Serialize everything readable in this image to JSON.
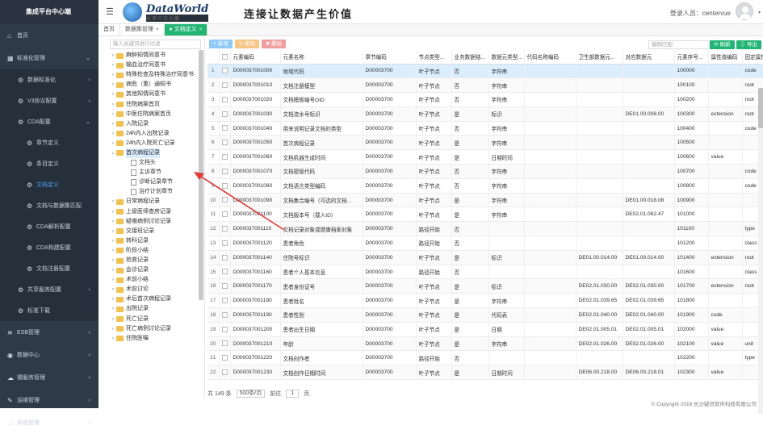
{
  "brand": "集成平台中心端",
  "sidebar": [
    {
      "label": "首页",
      "icon": "home-icon",
      "glyph": "⌂"
    },
    {
      "label": "标准化管理",
      "icon": "grid-icon",
      "glyph": "▦",
      "arrow": "⌄"
    },
    {
      "label": "数据标准化",
      "icon": "gear-icon",
      "glyph": "⚙",
      "arrow": "‹",
      "level": 1
    },
    {
      "label": "V3协议配置",
      "icon": "gear-icon",
      "glyph": "⚙",
      "arrow": "‹",
      "level": 1
    },
    {
      "label": "CDA配置",
      "icon": "gear-icon",
      "glyph": "⚙",
      "arrow": "⌄",
      "level": 1
    },
    {
      "label": "章节定义",
      "icon": "gear-icon",
      "glyph": "⚙",
      "level": 2
    },
    {
      "label": "条目定义",
      "icon": "gear-icon",
      "glyph": "⚙",
      "level": 2
    },
    {
      "label": "文档定义",
      "icon": "gear-icon",
      "glyph": "⚙",
      "level": 2,
      "active": true
    },
    {
      "label": "文档与数据集匹配",
      "icon": "gear-icon",
      "glyph": "⚙",
      "level": 2
    },
    {
      "label": "CDA解析配置",
      "icon": "gear-icon",
      "glyph": "⚙",
      "level": 2
    },
    {
      "label": "CDA构建配置",
      "icon": "gear-icon",
      "glyph": "⚙",
      "level": 2
    },
    {
      "label": "文档注册配置",
      "icon": "gear-icon",
      "glyph": "⚙",
      "level": 2
    },
    {
      "label": "共享服务配置",
      "icon": "gear-icon",
      "glyph": "⚙",
      "arrow": "‹",
      "level": 1
    },
    {
      "label": "标准下载",
      "icon": "gear-icon",
      "glyph": "⚙",
      "level": 1
    },
    {
      "label": "ESB管理",
      "icon": "layers-icon",
      "glyph": "≋",
      "arrow": "‹"
    },
    {
      "label": "数据中心",
      "icon": "database-icon",
      "glyph": "◉",
      "arrow": "‹"
    },
    {
      "label": "微服务管理",
      "icon": "cloud-icon",
      "glyph": "☁",
      "arrow": "‹"
    },
    {
      "label": "运维管理",
      "icon": "wrench-icon",
      "glyph": "✎",
      "arrow": "‹"
    },
    {
      "label": "系统管理",
      "icon": "monitor-icon",
      "glyph": "▭",
      "arrow": "‹"
    }
  ],
  "header": {
    "logo_name": "DataWorld",
    "logo_sub": "共享开放共赢",
    "slogan": "连接让数据产生价值",
    "user_label": "登录人员：centervue",
    "menu_icon": "☰",
    "avatar_arrow": "▾"
  },
  "tabs": [
    {
      "label": "首页"
    },
    {
      "label": "数据集管理",
      "close": "×"
    },
    {
      "label": "● 文档定义",
      "close": "×",
      "active": true
    }
  ],
  "tree": {
    "search_placeholder": "输入关键词进行过滤",
    "items": [
      {
        "label": "麻醉知情同意书",
        "t": "f"
      },
      {
        "label": "输血治疗同意书",
        "t": "f"
      },
      {
        "label": "特殊检查及特殊治疗同意书",
        "t": "f"
      },
      {
        "label": "病危（重）通知书",
        "t": "f"
      },
      {
        "label": "其他知情同意书",
        "t": "f"
      },
      {
        "label": "住院病案首页",
        "t": "f"
      },
      {
        "label": "中医住院病案首页",
        "t": "f"
      },
      {
        "label": "入院记录",
        "t": "f"
      },
      {
        "label": "24h内入出院记录",
        "t": "f"
      },
      {
        "label": "24h内入院死亡记录",
        "t": "f"
      },
      {
        "label": "首次病程记录",
        "t": "o",
        "sel": true
      },
      {
        "label": "文档头",
        "t": "l"
      },
      {
        "label": "主诉章节",
        "t": "l"
      },
      {
        "label": "诊断记录章节",
        "t": "l"
      },
      {
        "label": "治疗计划章节",
        "t": "l"
      },
      {
        "label": "日常病程记录",
        "t": "f"
      },
      {
        "label": "上级医师查房记录",
        "t": "f"
      },
      {
        "label": "疑难病例讨论记录",
        "t": "f"
      },
      {
        "label": "交接班记录",
        "t": "f"
      },
      {
        "label": "转科记录",
        "t": "f"
      },
      {
        "label": "阶段小结",
        "t": "f"
      },
      {
        "label": "抢救记录",
        "t": "f"
      },
      {
        "label": "会诊记录",
        "t": "f"
      },
      {
        "label": "术前小结",
        "t": "f"
      },
      {
        "label": "术前讨论",
        "t": "f"
      },
      {
        "label": "术后首次病程记录",
        "t": "f"
      },
      {
        "label": "出院记录",
        "t": "f"
      },
      {
        "label": "死亡记录",
        "t": "f"
      },
      {
        "label": "死亡病例讨论记录",
        "t": "f"
      },
      {
        "label": "住院医嘱",
        "t": "f"
      }
    ]
  },
  "toolbar": {
    "add": "+ 新增",
    "edit": "✎ 修改",
    "del": "✖ 删除",
    "search_placeholder": "模糊匹配",
    "refresh": "⟳ 刷新",
    "export": "⇩ 导出"
  },
  "columns": [
    "",
    "",
    "元素编码",
    "元素名称",
    "章节编码",
    "节点类型...",
    "业务数据结...",
    "数据元类型...",
    "代码名称编码",
    "卫生部数据元...",
    "对应数据元",
    "元素序号...",
    "属性值编码",
    "固定属性"
  ],
  "rows": [
    [
      "1",
      "D000037001000",
      "地域代码",
      "D00003700",
      "叶子节点",
      "否",
      "字符串",
      "",
      "",
      "",
      "100000",
      "",
      "code"
    ],
    [
      "2",
      "D000037001010",
      "文档注册模型",
      "D00003700",
      "叶子节点",
      "否",
      "字符串",
      "",
      "",
      "",
      "100100",
      "",
      "root"
    ],
    [
      "3",
      "D000037001020",
      "文档模板编号OID",
      "D00003700",
      "叶子节点",
      "否",
      "字符串",
      "",
      "",
      "",
      "100200",
      "",
      "root"
    ],
    [
      "4",
      "D000037001030",
      "文档流水号标识",
      "D00003700",
      "叶子节点",
      "是",
      "标识",
      "",
      "",
      "DE01.00.008.00",
      "100300",
      "extension",
      "root"
    ],
    [
      "5",
      "D000037001040",
      "用来说明记录文档的类型",
      "D00003700",
      "叶子节点",
      "否",
      "字符串",
      "",
      "",
      "",
      "100400",
      "",
      "code"
    ],
    [
      "6",
      "D000037001050",
      "首次病程记录",
      "D00003700",
      "叶子节点",
      "是",
      "字符串",
      "",
      "",
      "",
      "100500",
      "",
      ""
    ],
    [
      "7",
      "D000037001060",
      "文档机器生成时间",
      "D00003700",
      "叶子节点",
      "是",
      "日期时间",
      "",
      "",
      "",
      "100600",
      "value",
      ""
    ],
    [
      "8",
      "D000037001070",
      "文档密级代码",
      "D00003700",
      "叶子节点",
      "否",
      "字符串",
      "",
      "",
      "",
      "100700",
      "",
      "code"
    ],
    [
      "9",
      "D000037001080",
      "文档语言类型编码",
      "D00003700",
      "叶子节点",
      "否",
      "字符串",
      "",
      "",
      "",
      "100800",
      "",
      "code"
    ],
    [
      "10",
      "D000037001090",
      "文档集合编号（可选的文档...",
      "D00003700",
      "叶子节点",
      "是",
      "字符串",
      "",
      "",
      "DE01.00.018.08",
      "100900",
      "",
      ""
    ],
    [
      "11",
      "D000037001100",
      "文档版本号（载入ID）",
      "D00003700",
      "叶子节点",
      "是",
      "字符串",
      "",
      "",
      "DE02.01.062.47",
      "101000",
      "",
      ""
    ],
    [
      "12",
      "D000037001110",
      "文档记录对象或健康档案对象",
      "D00003700",
      "路径开始",
      "否",
      "",
      "",
      "",
      "",
      "101100",
      "",
      "type"
    ],
    [
      "13",
      "D000037001120",
      "患者角色",
      "D00003700",
      "路径开始",
      "否",
      "",
      "",
      "",
      "",
      "101200",
      "",
      "class"
    ],
    [
      "14",
      "D000037001140",
      "住院号标识",
      "D00003700",
      "叶子节点",
      "是",
      "标识",
      "",
      "DE01.00.014.00",
      "DE01.00.014.00",
      "101400",
      "extension",
      "root"
    ],
    [
      "15",
      "D000037001160",
      "患者个人基本信息",
      "D00003700",
      "路径开始",
      "否",
      "",
      "",
      "",
      "",
      "101600",
      "",
      "class"
    ],
    [
      "16",
      "D000037001170",
      "患者身份证号",
      "D00003700",
      "叶子节点",
      "是",
      "标识",
      "",
      "DE02.01.030.00",
      "DE02.01.030.00",
      "101700",
      "extension",
      "root"
    ],
    [
      "17",
      "D000037001180",
      "患者姓名",
      "D00003700",
      "叶子节点",
      "是",
      "字符串",
      "",
      "DE02.01.039.65",
      "DE02.01.039.65",
      "101800",
      "",
      ""
    ],
    [
      "18",
      "D000037001190",
      "患者性别",
      "D00003700",
      "叶子节点",
      "是",
      "代码表",
      "",
      "DE02.01.040.00",
      "DE02.01.040.00",
      "101900",
      "code",
      ""
    ],
    [
      "19",
      "D000037001200",
      "患者出生日期",
      "D00003700",
      "叶子节点",
      "是",
      "日期",
      "",
      "DE02.01.005.01",
      "DE02.01.005.01",
      "102000",
      "value",
      ""
    ],
    [
      "20",
      "D000037001210",
      "年龄",
      "D00003700",
      "叶子节点",
      "是",
      "字符串",
      "",
      "DE02.01.026.00",
      "DE02.01.026.00",
      "102100",
      "value",
      "unit"
    ],
    [
      "21",
      "D000037001220",
      "文档创作者",
      "D00003700",
      "路径开始",
      "否",
      "",
      "",
      "",
      "",
      "102200",
      "",
      "type"
    ],
    [
      "22",
      "D000037001230",
      "文档创作日期时间",
      "D00003700",
      "叶子节点",
      "是",
      "日期时间",
      "",
      "DE06.00.218.00",
      "DE06.00.218.01",
      "102300",
      "value",
      ""
    ]
  ],
  "pager": {
    "total": "共 149 条",
    "size": "500条/页",
    "prev": "前往",
    "page": "1",
    "unit": "页"
  },
  "footer": "© Copyright 2016 长沙疑讯软件科技有限公司"
}
